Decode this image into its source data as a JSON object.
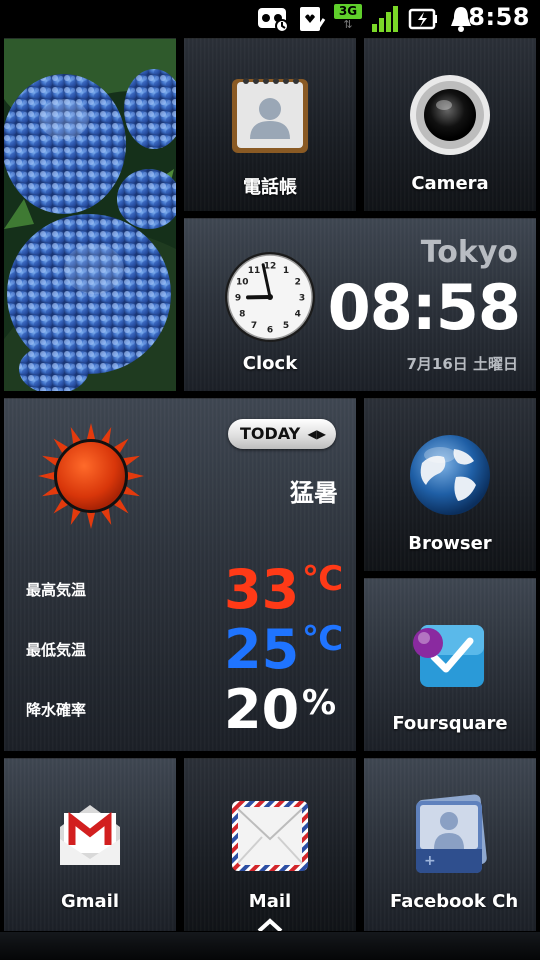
{
  "status_bar": {
    "time": "8:58",
    "network_type": "3G",
    "icons": [
      "voicemail-icon",
      "heart-monitor-icon",
      "3g-data-icon",
      "signal-bars-icon",
      "battery-charging-icon",
      "notification-bell-icon"
    ]
  },
  "tiles": {
    "contacts_label": "電話帳",
    "camera_label": "Camera",
    "clock_label": "Clock",
    "browser_label": "Browser",
    "foursquare_label": "Foursquare",
    "gmail_label": "Gmail",
    "mail_label": "Mail",
    "facebook_label": "Facebook Ch"
  },
  "clock_widget": {
    "city": "Tokyo",
    "time": "08:58",
    "date": "7月16日 土曜日",
    "dial_numbers": [
      "12",
      "1",
      "2",
      "3",
      "4",
      "5",
      "6",
      "7",
      "8",
      "9",
      "10",
      "11"
    ]
  },
  "weather": {
    "toggle_label": "TODAY",
    "condition": "猛暑",
    "high_label": "最高気温",
    "high_value": "33",
    "high_unit": "℃",
    "low_label": "最低気温",
    "low_value": "25",
    "low_unit": "℃",
    "rain_label": "降水確率",
    "rain_value": "20",
    "rain_unit": "%"
  },
  "colors": {
    "high_temp": "#ff3a17",
    "low_temp": "#1f74ff",
    "sun": "#e33a0d"
  }
}
